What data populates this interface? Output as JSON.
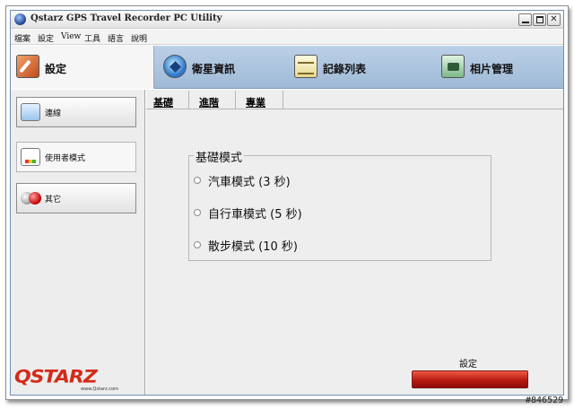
{
  "window": {
    "title": "Qstarz GPS Travel Recorder PC Utility"
  },
  "menu": [
    "檔案",
    "設定",
    "View",
    "工具",
    "語言",
    "說明"
  ],
  "toolbar": [
    {
      "label": "設定",
      "icon": "settings-icon",
      "active": true
    },
    {
      "label": "衛星資訊",
      "icon": "satellite-icon"
    },
    {
      "label": "記錄列表",
      "icon": "log-list-icon"
    },
    {
      "label": "相片管理",
      "icon": "photo-manage-icon"
    }
  ],
  "sidebar": [
    {
      "label": "連線",
      "icon": "connection-icon"
    },
    {
      "label": "使用者模式",
      "icon": "user-mode-icon",
      "active": true
    },
    {
      "label": "其它",
      "icon": "other-icon"
    }
  ],
  "logo": {
    "text": "QSTARZ",
    "url": "www.Qstarz.com"
  },
  "tabs": [
    "基礎",
    "進階",
    "專業"
  ],
  "basic_mode": {
    "title": "基礎模式",
    "options": [
      "汽車模式 (3 秒)",
      "自行車模式 (5 秒)",
      "散步模式 (10 秒)"
    ]
  },
  "apply": {
    "label": "設定"
  },
  "watermark": "#846529",
  "colors": {
    "toolbar": "#a9c1dc",
    "apply_button": "#c0281b",
    "logo": "#d42a1a"
  }
}
